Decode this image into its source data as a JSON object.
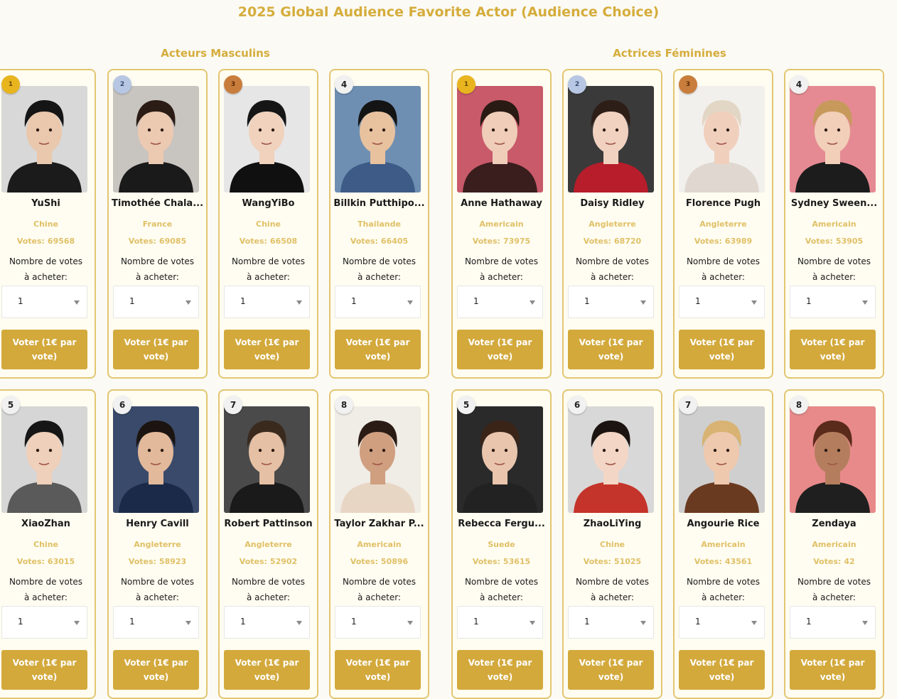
{
  "page": {
    "title": "2025 Global Audience Favorite Actor (Audience Choice)",
    "male_section_title": "Acteurs Masculins",
    "female_section_title": "Actrices Féminines"
  },
  "labels": {
    "votes_label": "Votes:",
    "buy_label_line1": "Nombre de votes",
    "buy_label_line2": "à acheter:",
    "quantity_default": "1",
    "vote_button": "Voter (1€ par vote)"
  },
  "male": [
    {
      "rank": "1",
      "medal": "gold",
      "name": "YuShi",
      "country": "Chine",
      "votes": "69568",
      "skin": "#e9c8ad",
      "hair": "#151515",
      "clothes": "#1b1b1b",
      "bg": "#d8d8d8"
    },
    {
      "rank": "2",
      "medal": "silver",
      "name": "Timothée Chala...",
      "country": "France",
      "votes": "69085",
      "skin": "#ecc9b1",
      "hair": "#2b1d15",
      "clothes": "#1a1a1a",
      "bg": "#c8c4c0"
    },
    {
      "rank": "3",
      "medal": "bronze",
      "name": "WangYiBo",
      "country": "Chine",
      "votes": "66508",
      "skin": "#f0d2bd",
      "hair": "#161616",
      "clothes": "#101010",
      "bg": "#e6e6e6"
    },
    {
      "rank": "4",
      "medal": "",
      "name": "Billkin Putthipo...",
      "country": "Thailande",
      "votes": "66405",
      "skin": "#e8c29f",
      "hair": "#141414",
      "clothes": "#3d5b86",
      "bg": "#6f8fb2"
    },
    {
      "rank": "5",
      "medal": "",
      "name": "XiaoZhan",
      "country": "Chine",
      "votes": "63015",
      "skin": "#efd0ba",
      "hair": "#161616",
      "clothes": "#5a5a5a",
      "bg": "#d6d6d6"
    },
    {
      "rank": "6",
      "medal": "",
      "name": "Henry Cavill",
      "country": "Angleterre",
      "votes": "58923",
      "skin": "#e2b99a",
      "hair": "#1b1410",
      "clothes": "#1c2a4a",
      "bg": "#3a4a6a"
    },
    {
      "rank": "7",
      "medal": "",
      "name": "Robert Pattinson",
      "country": "Angleterre",
      "votes": "52902",
      "skin": "#e5c0a4",
      "hair": "#3a2a1e",
      "clothes": "#1a1a1a",
      "bg": "#4a4a4a"
    },
    {
      "rank": "8",
      "medal": "",
      "name": "Taylor Zakhar P...",
      "country": "Americain",
      "votes": "50896",
      "skin": "#cf9f80",
      "hair": "#2a1c14",
      "clothes": "#e8d6c4",
      "bg": "#f0ece6"
    }
  ],
  "female": [
    {
      "rank": "1",
      "medal": "gold",
      "name": "Anne Hathaway",
      "country": "Americain",
      "votes": "73975",
      "skin": "#f0cdb8",
      "hair": "#2a1a14",
      "clothes": "#3a1d1d",
      "bg": "#c85a6a"
    },
    {
      "rank": "2",
      "medal": "silver",
      "name": "Daisy Ridley",
      "country": "Angleterre",
      "votes": "68720",
      "skin": "#f1d2c0",
      "hair": "#2e1e18",
      "clothes": "#b71d2a",
      "bg": "#3a3a3a"
    },
    {
      "rank": "3",
      "medal": "bronze",
      "name": "Florence Pugh",
      "country": "Angleterre",
      "votes": "63989",
      "skin": "#f0d0bd",
      "hair": "#e2d6c4",
      "clothes": "#e0d8d0",
      "bg": "#f2f0ed"
    },
    {
      "rank": "4",
      "medal": "",
      "name": "Sydney Sween...",
      "country": "Americain",
      "votes": "53905",
      "skin": "#f1cfb8",
      "hair": "#c79a5c",
      "clothes": "#1c1c1c",
      "bg": "#e58a93"
    },
    {
      "rank": "5",
      "medal": "",
      "name": "Rebecca Fergu...",
      "country": "Suede",
      "votes": "53615",
      "skin": "#e9c5ad",
      "hair": "#3a2418",
      "clothes": "#222222",
      "bg": "#2a2a2a"
    },
    {
      "rank": "6",
      "medal": "",
      "name": "ZhaoLiYing",
      "country": "Chine",
      "votes": "51025",
      "skin": "#f3d6c6",
      "hair": "#1c1410",
      "clothes": "#c5342a",
      "bg": "#d8d8d8"
    },
    {
      "rank": "7",
      "medal": "",
      "name": "Angourie Rice",
      "country": "Americain",
      "votes": "43561",
      "skin": "#efc9ae",
      "hair": "#d8b373",
      "clothes": "#6a3a20",
      "bg": "#cfcfcf"
    },
    {
      "rank": "8",
      "medal": "",
      "name": "Zendaya",
      "country": "Americain",
      "votes": "42",
      "skin": "#b47e5e",
      "hair": "#5a2a1a",
      "clothes": "#1f1f1f",
      "bg": "#e88a8a"
    }
  ]
}
